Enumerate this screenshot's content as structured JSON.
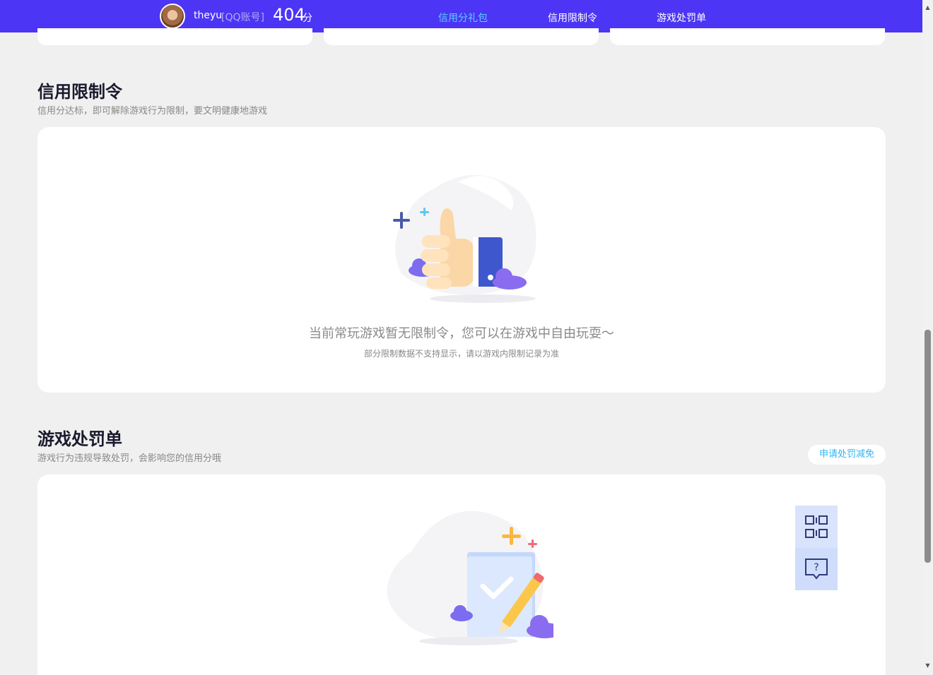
{
  "header": {
    "username": "theyu",
    "account_type": "[QQ账号]",
    "score": "404",
    "score_unit": "分",
    "tabs": [
      {
        "label": "信用分礼包",
        "active": true
      },
      {
        "label": "信用限制令",
        "active": false
      },
      {
        "label": "游戏处罚单",
        "active": false
      }
    ]
  },
  "restriction": {
    "title": "信用限制令",
    "subtitle": "信用分达标，即可解除游戏行为限制，要文明健康地游戏",
    "empty_text": "当前常玩游戏暂无限制令，您可以在游戏中自由玩耍～",
    "empty_note": "部分限制数据不支持显示，请以游戏内限制记录为准"
  },
  "penalty": {
    "title": "游戏处罚单",
    "subtitle": "游戏行为违规导致处罚，会影响您的信用分哦",
    "appeal_label": "申请处罚减免"
  },
  "floating": {
    "qr_icon": "qrcode-icon",
    "help_icon": "help-chat-icon"
  },
  "colors": {
    "topbar": "#4c35f5",
    "active_tab": "#5ad0ff",
    "link": "#2fb5f0"
  }
}
